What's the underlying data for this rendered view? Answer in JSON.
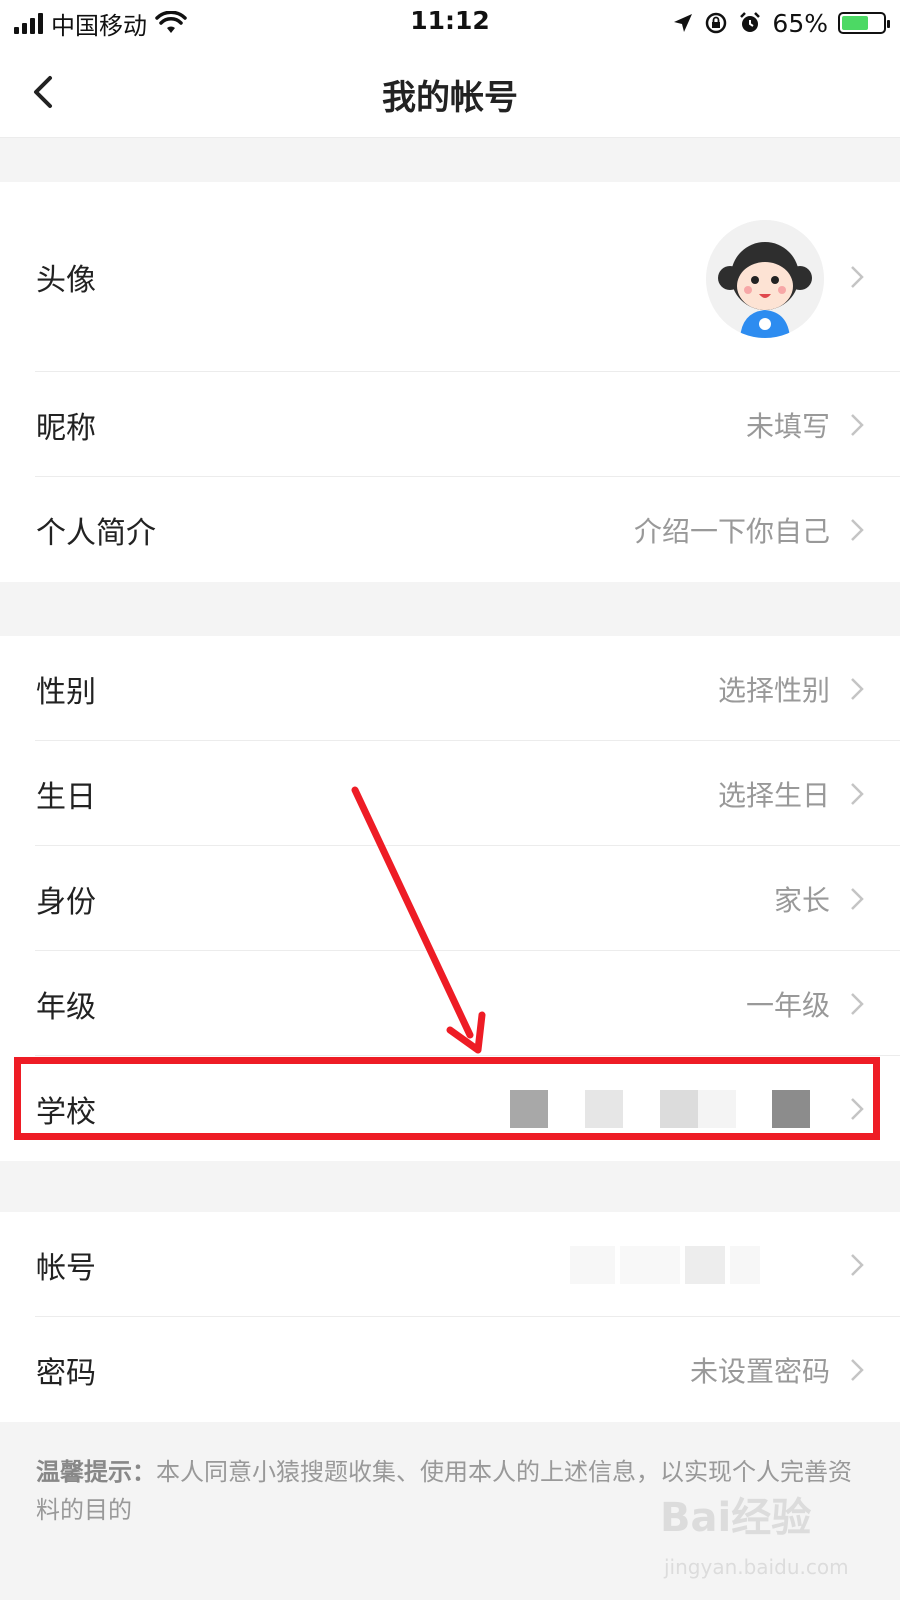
{
  "status_bar": {
    "carrier": "中国移动",
    "time": "11:12",
    "battery": "65%",
    "battery_level": 0.65
  },
  "nav": {
    "title": "我的帐号"
  },
  "group1": {
    "avatar_label": "头像",
    "nickname_label": "昵称",
    "nickname_value": "未填写",
    "bio_label": "个人简介",
    "bio_value": "介绍一下你自己"
  },
  "group2": {
    "gender_label": "性别",
    "gender_value": "选择性别",
    "birthday_label": "生日",
    "birthday_value": "选择生日",
    "identity_label": "身份",
    "identity_value": "家长",
    "grade_label": "年级",
    "grade_value": "一年级",
    "school_label": "学校"
  },
  "group3": {
    "account_label": "帐号",
    "password_label": "密码",
    "password_value": "未设置密码"
  },
  "tip": {
    "label": "温馨提示：",
    "text": "本人同意小猿搜题收集、使用本人的上述信息，以实现个人完善资料的目的"
  },
  "watermark": {
    "brand": "Bai经验",
    "url": "jingyan.baidu.com"
  },
  "colors": {
    "highlight": "#ee1c25",
    "value_text": "#999999",
    "divider": "#ececec"
  }
}
